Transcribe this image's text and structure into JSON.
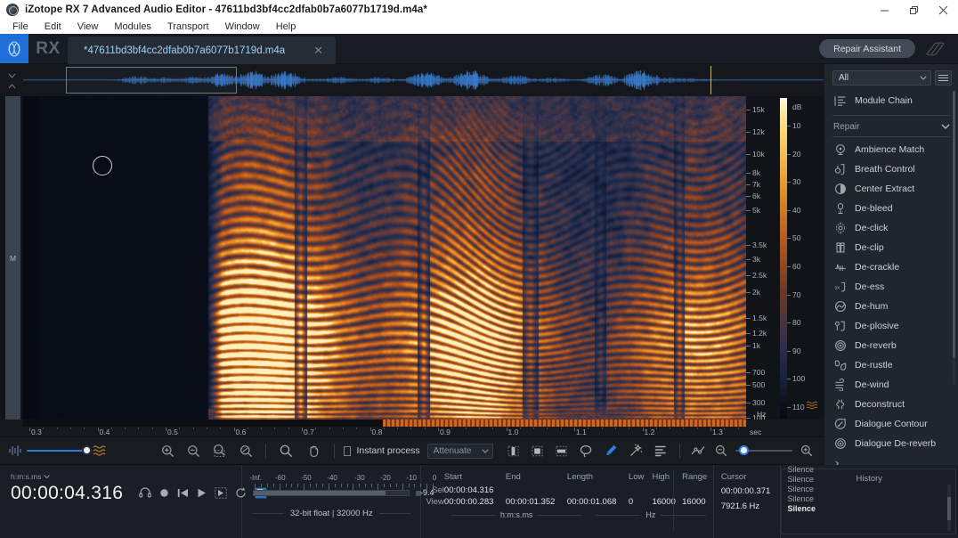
{
  "window": {
    "title": "iZotope RX 7 Advanced Audio Editor - 47611bd3bf4cc2dfab0b7a6077b1719d.m4a*",
    "minimize": "minimize-icon",
    "maximize": "restore-icon",
    "close": "close-icon"
  },
  "menu": {
    "items": [
      "File",
      "Edit",
      "View",
      "Modules",
      "Transport",
      "Window",
      "Help"
    ]
  },
  "header": {
    "logo": "rx-logo-icon",
    "wordmark": "RX",
    "tab_name": "*47611bd3bf4cc2dfab0b7a6077b1719d.m4a",
    "tab_close": "close-icon",
    "repair_assistant": "Repair Assistant",
    "rx_mark": "rx-waves-icon"
  },
  "overview": {
    "handle": "collapse-handle-icon"
  },
  "spectrogram": {
    "channel_label": "M",
    "freq_unit": "Hz",
    "freq_labels": [
      "15k",
      "12k",
      "10k",
      "8k",
      "7k",
      "6k",
      "5k",
      "3.5k",
      "3k",
      "2.5k",
      "2k",
      "1.5k",
      "1.2k",
      "1k",
      "700",
      "500",
      "300",
      "100"
    ],
    "db_unit": "dB",
    "db_labels": [
      "10",
      "20",
      "30",
      "40",
      "50",
      "60",
      "70",
      "80",
      "90",
      "100",
      "110"
    ],
    "time_unit": "sec",
    "time_labels": [
      "0.3",
      "0.4",
      "0.5",
      "0.6",
      "0.7",
      "0.8",
      "0.9",
      "1.0",
      "1.1",
      "1.2",
      "1.3"
    ]
  },
  "toolbar": {
    "waveform_icon": "waveform-icon",
    "spectrogram_icon": "spectrogram-icon",
    "zoom_in_time": "zoom-in-icon",
    "zoom_out_time": "zoom-out-icon",
    "zoom_to_selection": "zoom-selection-icon",
    "zoom_fit": "zoom-fit-icon",
    "magnifier_tool": "magnifier-tool-icon",
    "hand_tool": "hand-tool-icon",
    "instant_process_label": "Instant process",
    "instant_process_checked": false,
    "process_mode": "Attenuate",
    "time_selection_tool": "time-selection-icon",
    "time_freq_selection_tool": "time-frequency-selection-icon",
    "freq_selection_tool": "frequency-selection-icon",
    "lasso_tool": "lasso-tool-icon",
    "brush_tool": "brush-tool-icon",
    "magic_wand_tool": "magic-wand-icon",
    "harmonic_tool": "harmonic-selection-icon",
    "envelope_tool": "envelope-tool-icon",
    "zoom_out_right": "zoom-out-icon",
    "zoom_in_right": "zoom-in-icon"
  },
  "modules": {
    "filter_value": "All",
    "menu_icon": "hamburger-icon",
    "module_chain": "Module Chain",
    "group_label": "Repair",
    "items": [
      {
        "label": "Ambience Match",
        "icon": "ambience-match-icon"
      },
      {
        "label": "Breath Control",
        "icon": "breath-control-icon"
      },
      {
        "label": "Center Extract",
        "icon": "center-extract-icon"
      },
      {
        "label": "De-bleed",
        "icon": "de-bleed-icon"
      },
      {
        "label": "De-click",
        "icon": "de-click-icon"
      },
      {
        "label": "De-clip",
        "icon": "de-clip-icon"
      },
      {
        "label": "De-crackle",
        "icon": "de-crackle-icon"
      },
      {
        "label": "De-ess",
        "icon": "de-ess-icon"
      },
      {
        "label": "De-hum",
        "icon": "de-hum-icon"
      },
      {
        "label": "De-plosive",
        "icon": "de-plosive-icon"
      },
      {
        "label": "De-reverb",
        "icon": "de-reverb-icon"
      },
      {
        "label": "De-rustle",
        "icon": "de-rustle-icon"
      },
      {
        "label": "De-wind",
        "icon": "de-wind-icon"
      },
      {
        "label": "Deconstruct",
        "icon": "deconstruct-icon"
      },
      {
        "label": "Dialogue Contour",
        "icon": "dialogue-contour-icon"
      },
      {
        "label": "Dialogue De-reverb",
        "icon": "dialogue-dereverb-icon"
      }
    ],
    "more": "›"
  },
  "status": {
    "time_format": "h:m:s.ms",
    "playhead_time": "00:00:04.316",
    "transport": [
      "monitor-icon",
      "record-icon",
      "previous-icon",
      "play-icon",
      "play-selection-icon",
      "loop-icon",
      "export-selection-icon"
    ],
    "meter_labels": [
      "-Inf.",
      "-60",
      "-50",
      "-40",
      "-30",
      "-20",
      "-10",
      "0"
    ],
    "meter_peak": "-9.4",
    "file_format": "32-bit float | 32000 Hz",
    "columns": {
      "start": "Start",
      "end": "End",
      "length": "Length",
      "low": "Low",
      "high": "High",
      "range": "Range"
    },
    "row_sel_label": "Sel",
    "row_view_label": "View",
    "sel": {
      "start": "00:00:04.316",
      "end": "",
      "length": "",
      "low": "",
      "high": "",
      "range": ""
    },
    "view": {
      "start": "00:00:00.283",
      "end": "00:00:01.352",
      "length": "00:00:01.068",
      "low": "0",
      "high": "16000",
      "range": "16000"
    },
    "time_unit": "h:m:s.ms",
    "freq_unit": "Hz",
    "cursor_label": "Cursor",
    "cursor_time": "00:00:00.371",
    "cursor_freq": "7921.6 Hz",
    "history_label": "History",
    "history_items": [
      "Silence",
      "Silence",
      "Silence",
      "Silence",
      "Silence"
    ]
  }
}
